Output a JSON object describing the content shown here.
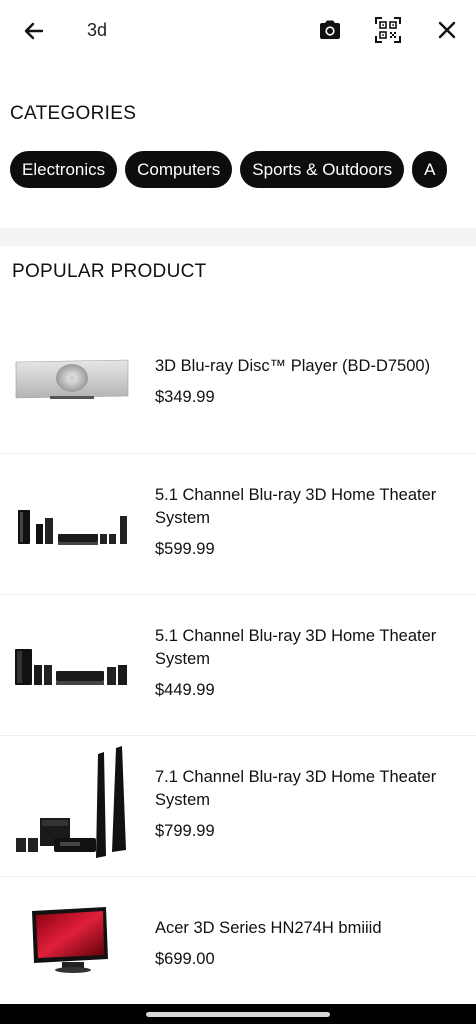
{
  "search": {
    "query": "3d"
  },
  "categories": {
    "title": "CATEGORIES",
    "items": [
      "Electronics",
      "Computers",
      "Sports & Outdoors",
      "A"
    ]
  },
  "popular": {
    "title": "POPULAR PRODUCT",
    "products": [
      {
        "name": "3D Blu-ray Disc™ Player (BD-D7500)",
        "price": "$349.99"
      },
      {
        "name": "5.1 Channel Blu-ray 3D Home Theater System",
        "price": "$599.99"
      },
      {
        "name": "5.1 Channel Blu-ray 3D Home Theater System",
        "price": "$449.99"
      },
      {
        "name": "7.1 Channel Blu-ray 3D Home Theater System",
        "price": "$799.99"
      },
      {
        "name": "Acer 3D Series HN274H bmiiid",
        "price": "$699.00"
      }
    ]
  },
  "icons": {
    "back": "arrow-left-icon",
    "camera": "camera-icon",
    "qr": "qr-code-icon",
    "close": "close-icon"
  },
  "colors": {
    "chip_bg": "#0d0d0d",
    "chip_text": "#ffffff",
    "band": "#f3f3f3"
  }
}
